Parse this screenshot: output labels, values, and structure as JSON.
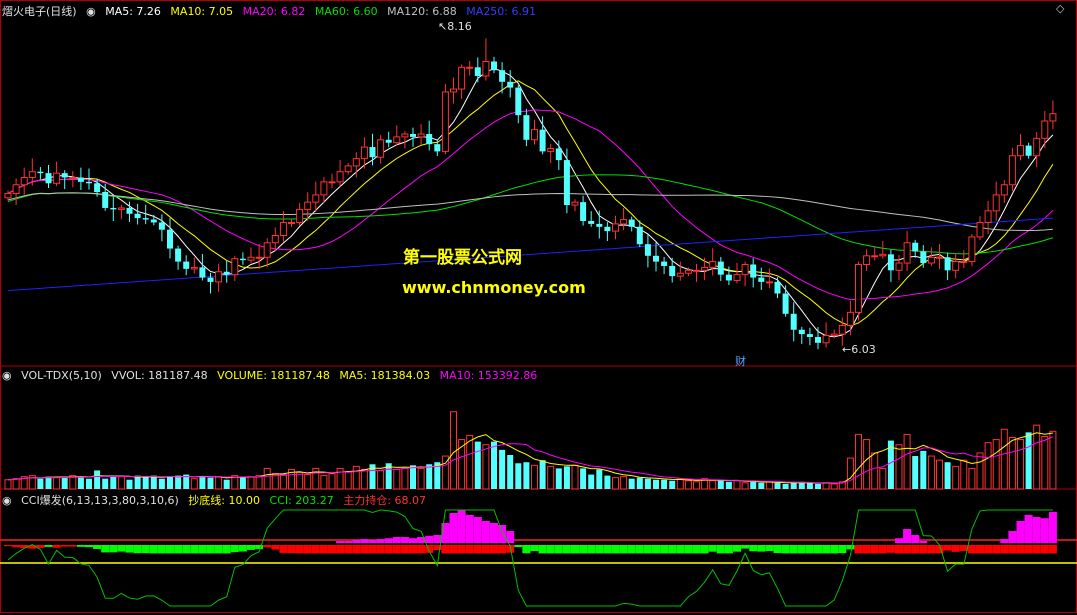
{
  "header_main": {
    "stock": "熠火电子(日线)",
    "ma5": "MA5: 7.26",
    "ma10": "MA10: 7.05",
    "ma20": "MA20: 6.82",
    "ma60": "MA60: 6.60",
    "ma120": "MA120: 6.88",
    "ma250": "MA250: 6.91"
  },
  "header_vol": {
    "name": "VOL-TDX(5,10)",
    "vvol": "VVOL: 181187.48",
    "volume": "VOLUME: 181187.48",
    "ma5": "MA5: 181384.03",
    "ma10": "MA10: 153392.86"
  },
  "header_cci": {
    "name": "CCI爆发(6,13,13,3,80,3,10,6)",
    "bottom_line": "抄底线: 10.00",
    "cci": "CCI: 203.27",
    "holding": "主力持仓: 68.07"
  },
  "watermark": {
    "line1": "第一股票公式网",
    "line2": "www.chnmoney.com"
  },
  "annotations": {
    "high_label": "8.16",
    "low_label": "6.03",
    "finance_marker": "财"
  },
  "colors": {
    "background": "#000000",
    "up": "#ff3232",
    "down": "#54ffff",
    "ma5": "#ffffff",
    "ma10": "#ffff00",
    "ma20": "#ff00ff",
    "ma60": "#00e000",
    "ma120": "#c0c0c0",
    "ma250": "#2020ff",
    "border": "#b00000"
  },
  "chart_data": {
    "type": "candlestick",
    "ylim": [
      5.9,
      8.3
    ],
    "opens": [
      7.06,
      7.09,
      7.15,
      7.2,
      7.24,
      7.23,
      7.16,
      7.23,
      7.2,
      7.2,
      7.17,
      7.16,
      7.1,
      6.99,
      6.98,
      6.99,
      6.95,
      6.92,
      6.91,
      6.89,
      6.84,
      6.71,
      6.62,
      6.57,
      6.58,
      6.51,
      6.48,
      6.55,
      6.53,
      6.64,
      6.63,
      6.65,
      6.65,
      6.75,
      6.8,
      6.89,
      6.89,
      6.98,
      7.03,
      7.08,
      7.17,
      7.17,
      7.24,
      7.28,
      7.33,
      7.41,
      7.34,
      7.46,
      7.44,
      7.48,
      7.5,
      7.48,
      7.5,
      7.43,
      7.38,
      7.79,
      7.81,
      7.96,
      7.96,
      7.9,
      8.0,
      7.94,
      7.86,
      7.82,
      7.63,
      7.46,
      7.53,
      7.38,
      7.4,
      7.32,
      7.01,
      7.03,
      6.9,
      6.88,
      6.86,
      6.83,
      6.88,
      6.91,
      6.86,
      6.74,
      6.66,
      6.62,
      6.59,
      6.52,
      6.54,
      6.56,
      6.56,
      6.58,
      6.62,
      6.53,
      6.49,
      6.53,
      6.6,
      6.51,
      6.48,
      6.48,
      6.4,
      6.26,
      6.15,
      6.12,
      6.1,
      6.06,
      6.11,
      6.12,
      6.18,
      6.27,
      6.6,
      6.66,
      6.66,
      6.67,
      6.56,
      6.61,
      6.75,
      6.69,
      6.61,
      6.65,
      6.65,
      6.56,
      6.62,
      6.62,
      6.79,
      6.89,
      6.97,
      7.08,
      7.15,
      7.35,
      7.42,
      7.35,
      7.47,
      7.59
    ],
    "closes": [
      7.09,
      7.15,
      7.2,
      7.24,
      7.23,
      7.16,
      7.23,
      7.2,
      7.2,
      7.17,
      7.16,
      7.1,
      6.99,
      6.98,
      6.99,
      6.95,
      6.92,
      6.91,
      6.89,
      6.84,
      6.71,
      6.62,
      6.57,
      6.58,
      6.51,
      6.48,
      6.55,
      6.53,
      6.64,
      6.63,
      6.65,
      6.65,
      6.75,
      6.8,
      6.89,
      6.89,
      6.98,
      7.03,
      7.08,
      7.17,
      7.17,
      7.24,
      7.28,
      7.33,
      7.41,
      7.34,
      7.46,
      7.44,
      7.48,
      7.5,
      7.48,
      7.5,
      7.43,
      7.38,
      7.79,
      7.81,
      7.96,
      7.96,
      7.9,
      8.0,
      7.94,
      7.86,
      7.82,
      7.63,
      7.46,
      7.53,
      7.38,
      7.4,
      7.32,
      7.01,
      7.03,
      6.9,
      6.88,
      6.86,
      6.83,
      6.88,
      6.91,
      6.86,
      6.74,
      6.66,
      6.62,
      6.59,
      6.52,
      6.54,
      6.56,
      6.56,
      6.58,
      6.62,
      6.53,
      6.49,
      6.53,
      6.6,
      6.51,
      6.48,
      6.48,
      6.4,
      6.26,
      6.15,
      6.12,
      6.1,
      6.06,
      6.11,
      6.12,
      6.18,
      6.27,
      6.6,
      6.66,
      6.66,
      6.67,
      6.56,
      6.61,
      6.75,
      6.69,
      6.61,
      6.65,
      6.65,
      6.56,
      6.62,
      6.62,
      6.79,
      6.89,
      6.97,
      7.08,
      7.15,
      7.35,
      7.42,
      7.35,
      7.47,
      7.59,
      7.64
    ],
    "high": 8.16,
    "low": 6.03,
    "volume": [
      0.09,
      0.1,
      0.12,
      0.13,
      0.1,
      0.12,
      0.11,
      0.12,
      0.13,
      0.12,
      0.1,
      0.18,
      0.1,
      0.13,
      0.12,
      0.09,
      0.13,
      0.12,
      0.13,
      0.1,
      0.12,
      0.13,
      0.14,
      0.1,
      0.12,
      0.11,
      0.12,
      0.09,
      0.13,
      0.12,
      0.12,
      0.13,
      0.2,
      0.15,
      0.14,
      0.19,
      0.16,
      0.14,
      0.2,
      0.13,
      0.15,
      0.2,
      0.17,
      0.22,
      0.19,
      0.24,
      0.18,
      0.25,
      0.19,
      0.2,
      0.23,
      0.2,
      0.24,
      0.26,
      0.32,
      0.75,
      0.48,
      0.52,
      0.46,
      0.43,
      0.46,
      0.38,
      0.33,
      0.25,
      0.26,
      0.23,
      0.28,
      0.22,
      0.2,
      0.22,
      0.23,
      0.2,
      0.14,
      0.19,
      0.13,
      0.11,
      0.12,
      0.1,
      0.11,
      0.1,
      0.09,
      0.09,
      0.08,
      0.1,
      0.08,
      0.07,
      0.1,
      0.08,
      0.09,
      0.07,
      0.08,
      0.06,
      0.07,
      0.06,
      0.07,
      0.06,
      0.05,
      0.06,
      0.07,
      0.06,
      0.05,
      0.06,
      0.05,
      0.07,
      0.3,
      0.53,
      0.48,
      0.35,
      0.2,
      0.47,
      0.43,
      0.53,
      0.32,
      0.37,
      0.32,
      0.28,
      0.26,
      0.22,
      0.28,
      0.2,
      0.35,
      0.45,
      0.48,
      0.58,
      0.5,
      0.48,
      0.55,
      0.62,
      0.51,
      0.56
    ],
    "cci_holding": [
      0.0,
      0.0,
      0.0,
      0.0,
      0.0,
      0.0,
      0.0,
      0.0,
      0.0,
      0.0,
      0.0,
      0.0,
      0.0,
      0.0,
      0.0,
      0.0,
      0.0,
      0.0,
      0.0,
      0.0,
      0.0,
      0.0,
      0.0,
      0.0,
      0.0,
      0.0,
      0.0,
      0.0,
      0.0,
      0.0,
      0.0,
      0.0,
      0.0,
      0.0,
      0.0,
      0.0,
      0.0,
      0.0,
      0.0,
      0.0,
      0.0,
      0.05,
      0.05,
      0.08,
      0.1,
      0.08,
      0.1,
      0.12,
      0.15,
      0.15,
      0.12,
      0.15,
      0.18,
      0.2,
      0.5,
      0.75,
      0.82,
      0.7,
      0.65,
      0.55,
      0.5,
      0.45,
      0.3,
      0.0,
      0.0,
      0.0,
      0.0,
      0.0,
      0.0,
      0.0,
      0.0,
      0.0,
      0.0,
      0.0,
      0.0,
      0.0,
      0.0,
      0.0,
      0.0,
      0.0,
      0.0,
      0.0,
      0.0,
      0.0,
      0.0,
      0.0,
      0.0,
      0.0,
      0.0,
      0.0,
      0.0,
      0.0,
      0.0,
      0.0,
      0.0,
      0.0,
      0.0,
      0.0,
      0.0,
      0.0,
      0.0,
      0.0,
      0.0,
      0.0,
      0.0,
      0.0,
      0.0,
      0.0,
      0.0,
      0.0,
      0.12,
      0.35,
      0.2,
      0.05,
      0.0,
      0.0,
      0.0,
      0.0,
      0.0,
      0.0,
      0.0,
      0.0,
      0.0,
      0.1,
      0.3,
      0.55,
      0.7,
      0.65,
      0.62,
      0.78,
      0.72,
      0.75,
      0.8,
      0.78
    ]
  }
}
